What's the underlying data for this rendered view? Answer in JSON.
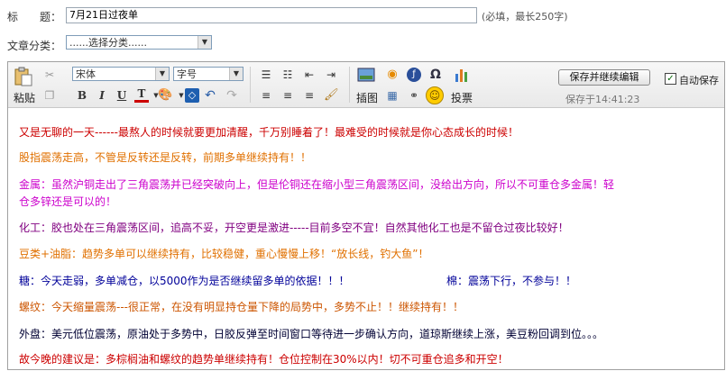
{
  "form": {
    "title_label": "标　　题：",
    "title_value": "7月21日过夜单",
    "title_hint": "(必填，最长250字)",
    "category_label": "文章分类：",
    "category_value": "......选择分类......"
  },
  "toolbar": {
    "paste_label": "粘贴",
    "font_value": "宋体",
    "size_value": "字号",
    "insert_image_label": "插图",
    "vote_label": "投票",
    "save_continue_label": "保存并继续编辑",
    "saved_time": "保存于14:41:23",
    "autosave_label": "自动保存",
    "bold": "B",
    "italic": "I",
    "underline": "U",
    "text_color": "T",
    "omega": "Ω"
  },
  "content": {
    "p1": "又是无聊的一天------最熬人的时候就要更加清醒，千万别睡着了！最难受的时候就是你心态成长的时候！",
    "p2": "股指震荡走高，不管是反转还是反转，前期多单继续持有！！",
    "p3a": "金属：虽然沪铜走出了三角震荡并已经突破向上，但是伦铜还在缩小型三角震荡区间，没给出方向，所以不可重仓多金属！轻",
    "p3b": "仓多锌还是可以的！",
    "p4": "化工：胶也处在三角震荡区间，追高不妥，开空更是激进-----目前多空不宜！自然其他化工也是不留仓过夜比较好！",
    "p5": "豆类+油脂：趋势多单可以继续持有，比较稳健，重心慢慢上移！“放长线，钓大鱼”！",
    "p6a": "糖：今天走弱，多单减仓，以5000作为是否继续留多单的依据！！！",
    "p6b": "棉：震荡下行，不参与！！",
    "p7": "螺纹：今天缩量震荡---很正常，在没有明显持仓量下降的局势中，多势不止！！继续持有！！",
    "p8": "外盘：美元低位震荡，原油处于多势中，日胶反弹至时间窗口等待进一步确认方向，道琼斯继续上涨，美豆粉回调到位。。。",
    "p9": "故今晚的建议是：多棕榈油和螺纹的趋势单继续持有！仓位控制在30%以内！切不可重仓追多和开空！"
  },
  "colors": {
    "red": "#cc0000",
    "orange": "#e07000",
    "magenta": "#cc00cc",
    "purple": "#800080",
    "navy": "#000099",
    "darkorange": "#cc5500",
    "dark": "#000033"
  }
}
